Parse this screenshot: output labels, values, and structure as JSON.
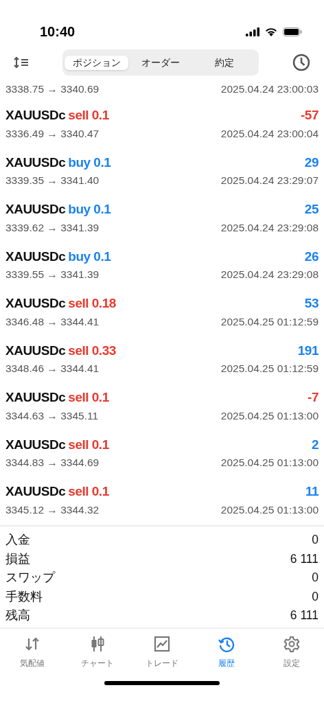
{
  "status_bar": {
    "time": "10:40"
  },
  "segments": [
    {
      "label": "ポジション",
      "selected": true
    },
    {
      "label": "オーダー",
      "selected": false
    },
    {
      "label": "約定",
      "selected": false
    }
  ],
  "first_row_tail": {
    "prices": "3338.75 → 3340.69",
    "time": "2025.04.24 23:00:03"
  },
  "deals": [
    {
      "symbol": "XAUUSDc",
      "kind": "sell",
      "side": "sell 0.1",
      "profit": "-57",
      "profit_negative": true,
      "prices": "3336.49 → 3340.47",
      "time": "2025.04.24 23:00:04"
    },
    {
      "symbol": "XAUUSDc",
      "kind": "buy",
      "side": "buy 0.1",
      "profit": "29",
      "profit_negative": false,
      "prices": "3339.35 → 3341.40",
      "time": "2025.04.24 23:29:07"
    },
    {
      "symbol": "XAUUSDc",
      "kind": "buy",
      "side": "buy 0.1",
      "profit": "25",
      "profit_negative": false,
      "prices": "3339.62 → 3341.39",
      "time": "2025.04.24 23:29:08"
    },
    {
      "symbol": "XAUUSDc",
      "kind": "buy",
      "side": "buy 0.1",
      "profit": "26",
      "profit_negative": false,
      "prices": "3339.55 → 3341.39",
      "time": "2025.04.24 23:29:08"
    },
    {
      "symbol": "XAUUSDc",
      "kind": "sell",
      "side": "sell 0.18",
      "profit": "53",
      "profit_negative": false,
      "prices": "3346.48 → 3344.41",
      "time": "2025.04.25 01:12:59"
    },
    {
      "symbol": "XAUUSDc",
      "kind": "sell",
      "side": "sell 0.33",
      "profit": "191",
      "profit_negative": false,
      "prices": "3348.46 → 3344.41",
      "time": "2025.04.25 01:12:59"
    },
    {
      "symbol": "XAUUSDc",
      "kind": "sell",
      "side": "sell 0.1",
      "profit": "-7",
      "profit_negative": true,
      "prices": "3344.63 → 3345.11",
      "time": "2025.04.25 01:13:00"
    },
    {
      "symbol": "XAUUSDc",
      "kind": "sell",
      "side": "sell 0.1",
      "profit": "2",
      "profit_negative": false,
      "prices": "3344.83 → 3344.69",
      "time": "2025.04.25 01:13:00"
    },
    {
      "symbol": "XAUUSDc",
      "kind": "sell",
      "side": "sell 0.1",
      "profit": "11",
      "profit_negative": false,
      "prices": "3345.12 → 3344.32",
      "time": "2025.04.25 01:13:00"
    }
  ],
  "summary": [
    {
      "label": "入金",
      "value": "0"
    },
    {
      "label": "損益",
      "value": "6 111"
    },
    {
      "label": "スワップ",
      "value": "0"
    },
    {
      "label": "手数料",
      "value": "0"
    },
    {
      "label": "残高",
      "value": "6 111"
    }
  ],
  "tab_bar": [
    {
      "label": "気配値",
      "selected": false
    },
    {
      "label": "チャート",
      "selected": false
    },
    {
      "label": "トレード",
      "selected": false
    },
    {
      "label": "履歴",
      "selected": true
    },
    {
      "label": "設定",
      "selected": false
    }
  ]
}
